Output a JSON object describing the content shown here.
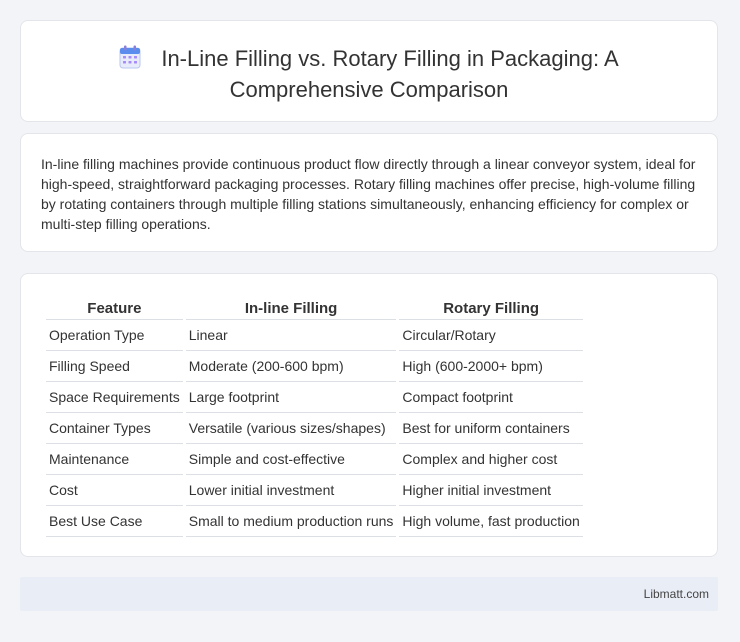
{
  "header": {
    "icon": "calendar-icon",
    "title_line1": "In-Line Filling vs. Rotary Filling in Packaging: A",
    "title_line2": "Comprehensive Comparison"
  },
  "intro": {
    "text": "In-line filling machines provide continuous product flow directly through a linear conveyor system, ideal for high-speed, straightforward packaging processes. Rotary filling machines offer precise, high-volume filling by rotating containers through multiple filling stations simultaneously, enhancing efficiency for complex or multi-step filling operations."
  },
  "table": {
    "headers": [
      "Feature",
      "In-line Filling",
      "Rotary Filling"
    ],
    "rows": [
      [
        "Operation Type",
        "Linear",
        "Circular/Rotary"
      ],
      [
        "Filling Speed",
        "Moderate (200-600 bpm)",
        "High (600-2000+ bpm)"
      ],
      [
        "Space Requirements",
        "Large footprint",
        "Compact footprint"
      ],
      [
        "Container Types",
        "Versatile (various sizes/shapes)",
        "Best for uniform containers"
      ],
      [
        "Maintenance",
        "Simple and cost-effective",
        "Complex and higher cost"
      ],
      [
        "Cost",
        "Lower initial investment",
        "Higher initial investment"
      ],
      [
        "Best Use Case",
        "Small to medium production runs",
        "High volume, fast production"
      ]
    ]
  },
  "footer": {
    "brand": "Libmatt.com"
  },
  "colors": {
    "background": "#f3f4f8",
    "card": "#ffffff",
    "footer": "#e9edf6",
    "icon_accent": "#5b8def"
  }
}
